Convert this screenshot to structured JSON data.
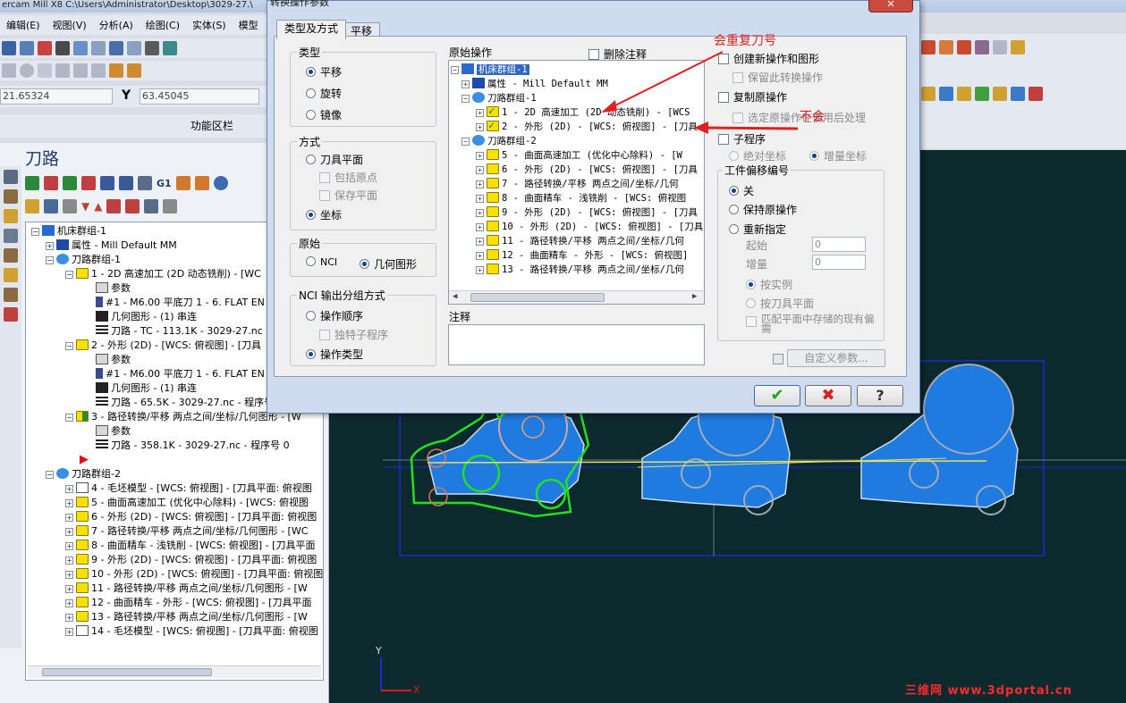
{
  "app": {
    "title": "ercam Mill X8  C:\\Users\\Administrator\\Desktop\\3029-27.\\",
    "menus": [
      "编辑(E)",
      "视图(V)",
      "分析(A)",
      "绘图(C)",
      "实体(S)",
      "模型"
    ],
    "coord_x_value": "21.65324",
    "coord_y_label": "Y",
    "coord_y_value": "63.45045",
    "function_area_label": "功能区栏",
    "panel_title": "刀路",
    "toolbar_g1": "G1"
  },
  "tree": {
    "rows": [
      {
        "t": "机床群组-1"
      },
      {
        "t": "属性 - Mill Default MM"
      },
      {
        "t": "刀路群组-1"
      },
      {
        "t": "1 - 2D 高速加工 (2D 动态铣削) - [WC"
      },
      {
        "t": "参数"
      },
      {
        "t": "#1 - M6.00 平底刀 1 - 6. FLAT EN"
      },
      {
        "t": "几何图形 - (1) 串连"
      },
      {
        "t": "刀路 - TC - 113.1K - 3029-27.nc -"
      },
      {
        "t": "2 - 外形 (2D) - [WCS: 俯视图] - [刀具"
      },
      {
        "t": "参数"
      },
      {
        "t": "#1 - M6.00 平底刀 1 - 6. FLAT EN"
      },
      {
        "t": "几何图形 - (1) 串连"
      },
      {
        "t": "刀路 - 65.5K - 3029-27.nc - 程序号"
      },
      {
        "t": "3 - 路径转换/平移 两点之间/坐标/几何图形 - [W"
      },
      {
        "t": "参数"
      },
      {
        "t": "刀路 - 358.1K - 3029-27.nc - 程序号 0"
      },
      {
        "t": ""
      },
      {
        "t": "刀路群组-2"
      },
      {
        "t": "4 - 毛坯模型 - [WCS: 俯视图] - [刀具平面: 俯视图"
      },
      {
        "t": "5 - 曲面高速加工 (优化中心除料) - [WCS: 俯视图"
      },
      {
        "t": "6 - 外形 (2D) - [WCS: 俯视图] - [刀具平面: 俯视图"
      },
      {
        "t": "7 - 路径转换/平移 两点之间/坐标/几何图形 - [WC"
      },
      {
        "t": "8 - 曲面精车 - 浅铣削 - [WCS: 俯视图] - [刀具平面"
      },
      {
        "t": "9 - 外形 (2D) - [WCS: 俯视图] - [刀具平面: 俯视图"
      },
      {
        "t": "10 - 外形 (2D) - [WCS: 俯视图] - [刀具平面: 俯视图"
      },
      {
        "t": "11 - 路径转换/平移 两点之间/坐标/几何图形 - [W"
      },
      {
        "t": "12 - 曲面精车 - 外形 - [WCS: 俯视图] - [刀具平面"
      },
      {
        "t": "13 - 路径转换/平移 两点之间/坐标/几何图形 - [W"
      },
      {
        "t": "14 - 毛坯模型 - [WCS: 俯视图] - [刀具平面: 俯视图"
      }
    ]
  },
  "dialog": {
    "title": "转换操作参数",
    "tabs": [
      "类型及方式",
      "平移"
    ],
    "type_group": "类型",
    "type_options": [
      "平移",
      "旋转",
      "镜像"
    ],
    "method_group": "方式",
    "method_options": [
      "刀具平面",
      "包括原点",
      "保存平面",
      "坐标"
    ],
    "origin_group": "原始",
    "origin_options": [
      "NCI",
      "几何图形"
    ],
    "nci_group": "NCI 输出分组方式",
    "nci_options": [
      "操作顺序",
      "独特子程序",
      "操作类型"
    ],
    "source_ops_label": "原始操作",
    "delete_comments": "删除注释",
    "optree": [
      {
        "t": "机床群组-1"
      },
      {
        "t": "属性 - Mill Default MM"
      },
      {
        "t": "刀路群组-1"
      },
      {
        "t": "1 - 2D 高速加工 (2D 动态铣削) - [WCS"
      },
      {
        "t": "2 - 外形 (2D) - [WCS: 俯视图] - [刀具"
      },
      {
        "t": "刀路群组-2"
      },
      {
        "t": "5 - 曲面高速加工 (优化中心除料) - [W"
      },
      {
        "t": "6 - 外形 (2D) - [WCS: 俯视图] - [刀具"
      },
      {
        "t": "7 - 路径转换/平移 两点之间/坐标/几何"
      },
      {
        "t": "8 - 曲面精车 - 浅铣削 - [WCS: 俯视图"
      },
      {
        "t": "9 - 外形 (2D) - [WCS: 俯视图] - [刀具"
      },
      {
        "t": "10 - 外形 (2D) - [WCS: 俯视图] - [刀具"
      },
      {
        "t": "11 - 路径转换/平移 两点之间/坐标/几何"
      },
      {
        "t": "12 - 曲面精车 - 外形 - [WCS: 俯视图]"
      },
      {
        "t": "13 - 路径转换/平移 两点之间/坐标/几何"
      }
    ],
    "notes_label": "注释",
    "create_new": "创建新操作和图形",
    "keep_transform": "保留此转换操作",
    "copy_source": "复制原操作",
    "selected_after": "选定原操作在使用后处理",
    "subprogram": "子程序",
    "absolute": "绝对坐标",
    "incremental": "增量坐标",
    "offset_group": "工件偏移编号",
    "offset_options": [
      "关",
      "保持原操作",
      "重新指定"
    ],
    "start_label": "起始",
    "start_value": "0",
    "inc_label": "增量",
    "inc_value": "0",
    "by_instance": "按实例",
    "by_tool_plane": "按刀具平面",
    "match_plane": "匹配平面中存储的现有偏需",
    "custom_params": "自定义参数..."
  },
  "annotations": {
    "repeat_tool": "会重复刀号",
    "no_repeat": "不会"
  },
  "graphics": {
    "axis_y": "Y",
    "axis_x": "X"
  },
  "watermark": "三维网 www.3dportal.cn",
  "colors": {
    "toolpath_blue": "#1f7be0",
    "chain_green": "#22e022",
    "annotation_red": "#e02020",
    "selection_blue": "#3167c4"
  }
}
